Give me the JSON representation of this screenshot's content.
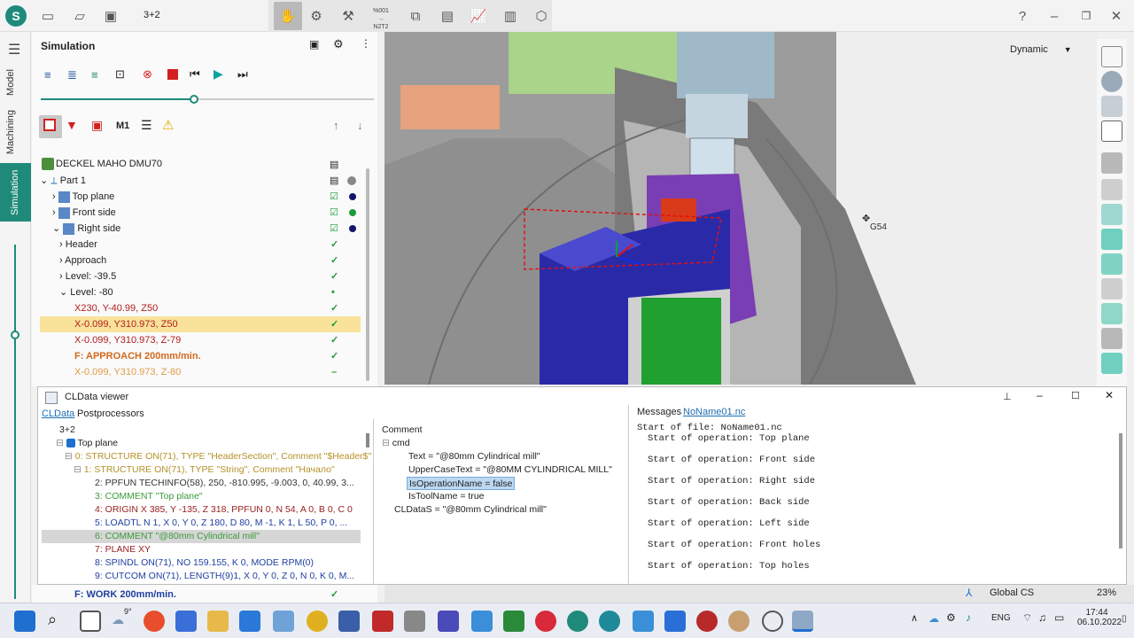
{
  "titlebar": {
    "title": "3+2",
    "help": "?",
    "nc_label_top": "%001",
    "nc_label_bottom": "N2T2"
  },
  "rail": {
    "tabs": [
      "Model",
      "Machining",
      "Simulation"
    ]
  },
  "panel": {
    "title": "Simulation",
    "progress": 0.46,
    "tool_m_label": "M1",
    "machine": "DECKEL MAHO DMU70",
    "rows": [
      {
        "label": "Part 1"
      },
      {
        "label": "Top plane"
      },
      {
        "label": "Front side"
      },
      {
        "label": "Right side"
      },
      {
        "label": "Header"
      },
      {
        "label": "Approach"
      },
      {
        "label": "Level: -39.5"
      },
      {
        "label": "Level: -80"
      },
      {
        "label": "X230, Y-40.99, Z50"
      },
      {
        "label": "X-0.099, Y310.973, Z50"
      },
      {
        "label": "X-0.099, Y310.973, Z-79"
      },
      {
        "label": "F: APPROACH 200mm/min."
      },
      {
        "label": "X-0.099, Y310.973, Z-80"
      },
      {
        "label": "F: WORK 200mm/min."
      }
    ]
  },
  "viewport": {
    "mode": "Dynamic",
    "wcs_label": "G54",
    "cs_label": "Global CS",
    "zoom": "23%"
  },
  "cldata": {
    "title": "CLData viewer",
    "tabs": [
      "CLData",
      "Postprocessors"
    ],
    "root": "3+2",
    "lines": [
      "Top plane",
      "0: STRUCTURE  ON(71), TYPE \"HeaderSection\", Comment \"$Header$\"",
      "1: STRUCTURE  ON(71), TYPE \"String\", Comment \"Начало\"",
      "2: PPFUN      TECHINFO(58), 250, -810.995, -9.003, 0, 40.99, 3...",
      "3: COMMENT    \"Top plane\"",
      "4: ORIGIN     X 385, Y -135, Z 318, PPFUN 0, N 54, A 0, B 0, C 0",
      "5: LOADTL     N 1, X 0, Y 0, Z 180, D 80, M -1, K 1, L 50, P 0, ...",
      "6: COMMENT    \"@80mm Cylindrical mill\"",
      "7: PLANE      XY",
      "8: SPINDL     ON(71), NO 159.155, K 0, MODE RPM(0)",
      "9: CUTCOM     ON(71), LENGTH(9)1, X 0, Y 0, Z 0, N 0, K 0, M..."
    ],
    "comment": {
      "header": "Comment",
      "cmd": "cmd",
      "props": [
        "Text = \"@80mm Cylindrical mill\"",
        "UpperCaseText = \"@80MM CYLINDRICAL MILL\"",
        "IsOperationName = false",
        "IsToolName = true"
      ],
      "cldatas": "CLDataS = \"@80mm Cylindrical mill\""
    },
    "messages": {
      "tabs": [
        "Messages",
        "NoName01.nc"
      ],
      "lines": [
        "Start of file: NoName01.nc",
        "Start of operation: Top plane",
        "Start of operation: Front side",
        "Start of operation: Right side",
        "Start of operation: Back side",
        "Start of operation: Left side",
        "Start of operation: Front holes",
        "Start of operation: Top holes"
      ]
    }
  },
  "taskbar": {
    "weather": "9°",
    "lang": "ENG",
    "time": "17:44",
    "date": "06.10.2022"
  },
  "colors": {
    "accent": "#1f8a7a",
    "selected": "#f9e39b",
    "ok": "#1f9a3c",
    "red": "#b01c1c",
    "orange": "#d2691e"
  }
}
